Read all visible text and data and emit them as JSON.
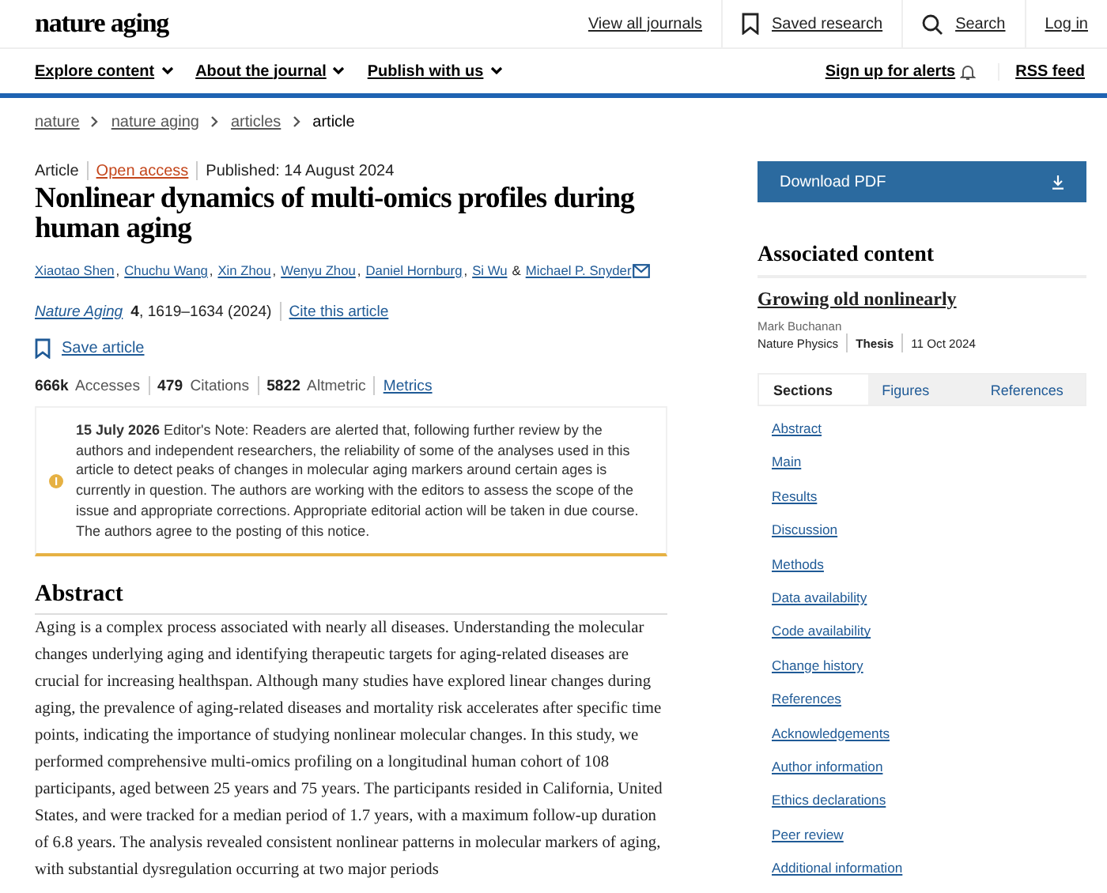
{
  "header": {
    "logo": "nature aging",
    "links": [
      "View all journals",
      "Saved research",
      "Search",
      "Log in"
    ]
  },
  "nav": {
    "menus": [
      "Explore content",
      "About the journal",
      "Publish with us"
    ],
    "alerts": "Sign up for alerts",
    "rss": "RSS feed"
  },
  "breadcrumb": [
    {
      "label": "nature",
      "current": false
    },
    {
      "label": "nature aging",
      "current": false
    },
    {
      "label": "articles",
      "current": false
    },
    {
      "label": "article",
      "current": true
    }
  ],
  "article": {
    "type": "Article",
    "access": "Open access",
    "published": "Published: 14 August 2024",
    "title": "Nonlinear dynamics of multi-omics profiles during human aging",
    "authors": [
      {
        "name": "Xiaotao Shen",
        "after": ",",
        "email": false
      },
      {
        "name": "Chuchu Wang",
        "after": ",",
        "email": false
      },
      {
        "name": "Xin Zhou",
        "after": ",",
        "email": false
      },
      {
        "name": "Wenyu Zhou",
        "after": ",",
        "email": false
      },
      {
        "name": "Daniel Hornburg",
        "after": ",",
        "email": false
      },
      {
        "name": "Si Wu",
        "after": "&",
        "email": false
      },
      {
        "name": "Michael P. Snyder",
        "email": true
      }
    ],
    "journal": "Nature Aging",
    "citation": "**4**, 1619–1634 (2024)",
    "cite": "Cite this article",
    "save": "Save article",
    "metrics": [
      "**666k** Accesses",
      "**479** Citations",
      "**5822** Altmetric"
    ],
    "metrics_link": "Metrics",
    "notice": "**15 July 2026** Editor's Note: Readers are alerted that, following further review by the authors and independent researchers, the reliability of some of the analyses used in this article to detect peaks of changes in molecular aging markers around certain ages is currently in question. The authors are working with the editors to assess the scope of the issue and appropriate corrections. Appropriate editorial action will be taken in due course. The authors agree to the posting of this notice.",
    "abstract_heading": "Abstract",
    "abstract": "Aging is a complex process associated with nearly all diseases. Understanding the molecular changes underlying aging and identifying therapeutic targets for aging-related diseases are crucial for increasing healthspan. Although many studies have explored linear changes during aging, the prevalence of aging-related diseases and mortality risk accelerates after specific time points, indicating the importance of studying nonlinear molecular changes. In this study, we performed comprehensive multi-omics profiling on a longitudinal human cohort of 108 participants, aged between 25 years and 75 years. The participants resided in California, United States, and were tracked for a median period of 1.7 years, with a maximum follow-up duration of 6.8 years. The analysis revealed consistent nonlinear patterns in molecular markers of aging, with substantial dysregulation occurring at two major periods"
  },
  "sidebar": {
    "download": "Download PDF",
    "assoc_heading": "Associated content",
    "assoc_title": "Growing old nonlinearly",
    "assoc_author": "Mark Buchanan",
    "assoc_journal": "Nature Physics",
    "assoc_type": "Thesis",
    "assoc_date": "11 Oct 2024",
    "tabs": [
      {
        "label": "Sections",
        "selected": true
      },
      {
        "label": "Figures",
        "selected": false
      },
      {
        "label": "References",
        "selected": false
      }
    ],
    "sections": [
      "Abstract",
      "Main",
      "Results",
      "Discussion",
      "Methods",
      "Data availability",
      "Code availability",
      "Change history",
      "References",
      "Acknowledgements",
      "Author information",
      "Ethics declarations",
      "Peer review",
      "Additional information"
    ]
  }
}
